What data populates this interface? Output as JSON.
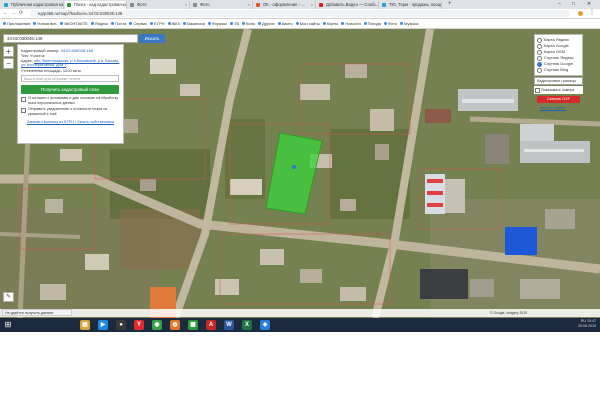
{
  "tabs": [
    {
      "label": "Публичная кадастровая карта",
      "active": false,
      "color": "#2a9fd6"
    },
    {
      "label": "Поиск - кад.кадастровая карта",
      "active": true,
      "color": "#2e9a3e"
    },
    {
      "label": "Фото",
      "active": false,
      "color": "#888888"
    },
    {
      "label": "Фото",
      "active": false,
      "color": "#888888"
    },
    {
      "label": "ОК - оформление - ...",
      "active": false,
      "color": "#e8532d"
    },
    {
      "label": "Добавить Видео — Сооб...",
      "active": false,
      "color": "#e02020"
    },
    {
      "label": "ТЮ, Терм - продажа, посадоч...",
      "active": false,
      "color": "#2a9fd6"
    }
  ],
  "newtab": "+",
  "window": {
    "minimize": "–",
    "maximize": "□",
    "close": "✕"
  },
  "nav": {
    "back": "←",
    "forward": "→",
    "reload": "⟳",
    "url": "egrp365.ru/map/?kadnum=34:02:030045:148"
  },
  "bookmarks": [
    "Приложения",
    "Новая вкл.",
    "ВКОНТАКТЕ",
    "Яндекс",
    "Почта",
    "Сервис",
    "ЕГРН",
    "ЖКХ",
    "Вакансии",
    "Форумы",
    "ТВ",
    "Кино",
    "Другое",
    "Авито",
    "Мои сайты",
    "Карты",
    "Новости",
    "Погода",
    "Фото",
    "Музыка"
  ],
  "search": {
    "value": "34:02:030045:148",
    "button": "Искать"
  },
  "info": {
    "kadnum_label": "Кадастровый номер:",
    "kadnum_value": "34:02:030045:148",
    "type_label": "Тип: Участок",
    "address_label": "Адрес:",
    "address_value": "обл. Волгоградская, р-н Быковский, р.п. Быково, ул. Кооперативная, дом 7",
    "area_label": "Уточненная площадь: 1200 кв.м",
    "area_placeholder": "Ваш e-mail для отправки отчета",
    "get_plan_button": "Получить кадастровый план",
    "check1": "Я согласен с условиями и даю согласие на обработку моих персональных данных",
    "check2": "Отправить уведомление о готовности плана на указанный e-mail",
    "bottom_link": "Заказать выписку из ЕГРН / Узнать собственника"
  },
  "zoom": {
    "in": "+",
    "out": "−"
  },
  "tool": "✎",
  "layers": [
    {
      "label": "Карта Яндекс",
      "on": false
    },
    {
      "label": "Карта Google",
      "on": false
    },
    {
      "label": "Карта OSM",
      "on": false
    },
    {
      "label": "Спутник Яндекс",
      "on": false
    },
    {
      "label": "Спутник Google",
      "on": true
    },
    {
      "label": "Спутник Bing",
      "on": false
    }
  ],
  "layer_select": "Кадастровые границы",
  "layer_option": "Показывать номера",
  "red_button": "Скачать DXF",
  "right_link": "Что это такое?",
  "status_text": "Не удаётся получить данные",
  "copyright": "© Google, Imagery 2019",
  "taskbar": {
    "start": "⊞",
    "icons": [
      {
        "name": "folder",
        "glyph": "▤",
        "color": "#d9a33a"
      },
      {
        "name": "media",
        "glyph": "▶",
        "color": "#1e88e5"
      },
      {
        "name": "circle",
        "glyph": "●",
        "color": "#3a3a3a"
      },
      {
        "name": "yandex",
        "glyph": "Y",
        "color": "#e12a2a"
      },
      {
        "name": "chrome",
        "glyph": "◉",
        "color": "#3a9f45"
      },
      {
        "name": "firefox",
        "glyph": "◍",
        "color": "#e0762a"
      },
      {
        "name": "gallery",
        "glyph": "▦",
        "color": "#2e9a3e"
      },
      {
        "name": "pdf",
        "glyph": "A",
        "color": "#c62828"
      },
      {
        "name": "word",
        "glyph": "W",
        "color": "#2b579a"
      },
      {
        "name": "excel",
        "glyph": "X",
        "color": "#217346"
      },
      {
        "name": "explorer",
        "glyph": "◈",
        "color": "#2a7fd6"
      }
    ],
    "tray_lang": "RU",
    "tray_time": "15:47",
    "tray_date": "25.06.2019"
  }
}
